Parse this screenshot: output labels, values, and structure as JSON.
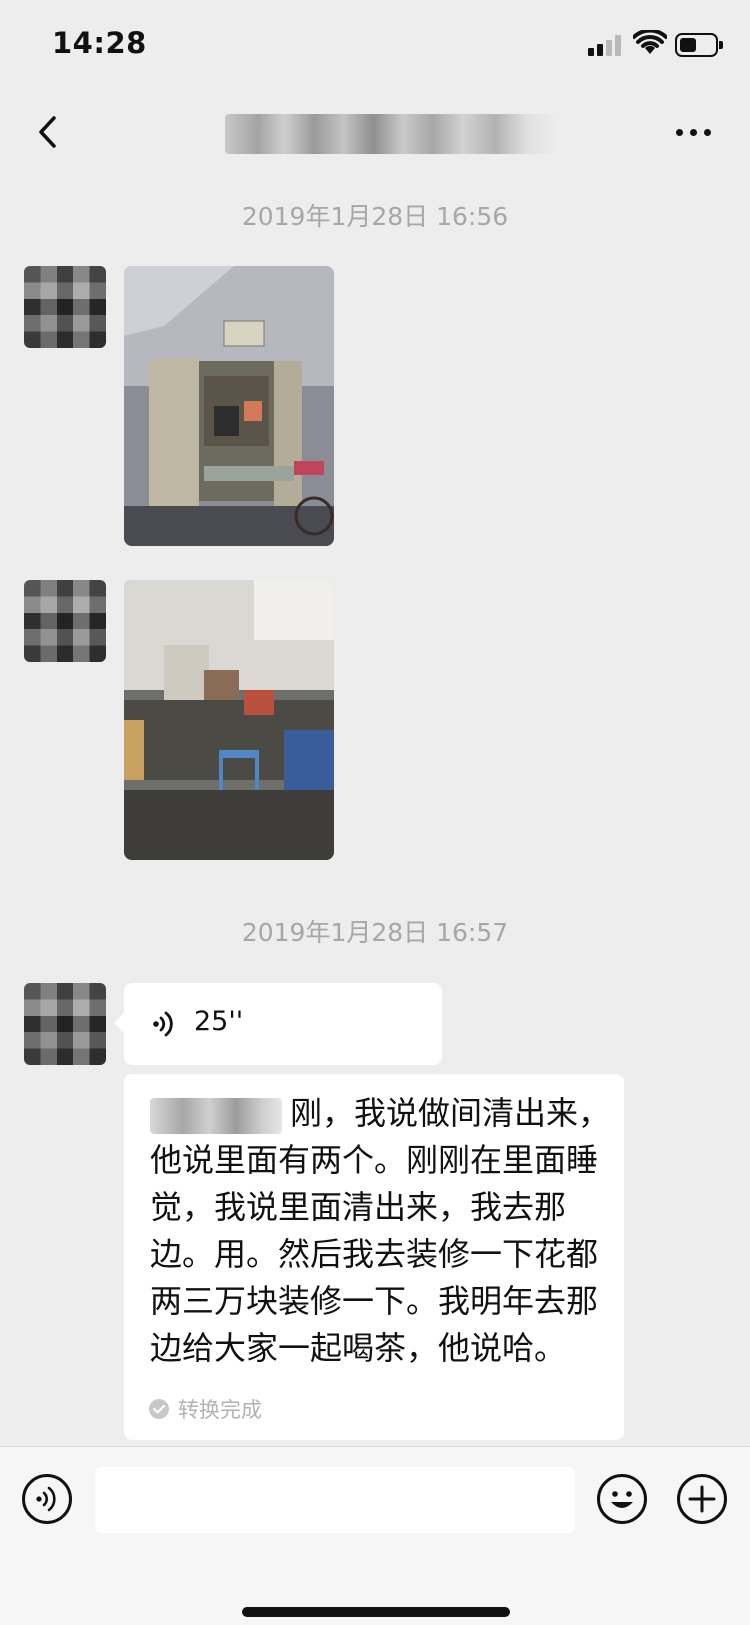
{
  "status_bar": {
    "time": "14:28"
  },
  "nav": {
    "back_icon": "chevron-left-icon",
    "title": "",
    "more_icon": "ellipsis-icon"
  },
  "messages": {
    "timestamp_1": "2019年1月28日 16:56",
    "image_1": "photo-room-doorway",
    "image_2": "photo-cluttered-room",
    "timestamp_2": "2019年1月28日 16:57",
    "voice": {
      "duration": "25''"
    },
    "transcript": {
      "text": "刚，我说做间清出来，他说里面有两个。刚刚在里面睡觉，我说里面清出来，我去那边。用。然后我去装修一下花都两三万块装修一下。我明年去那边给大家一起喝茶，他说哈。",
      "status": "转换完成"
    }
  },
  "input_bar": {
    "value": "",
    "placeholder": ""
  },
  "colors": {
    "background": "#ededed",
    "bubble": "#ffffff",
    "timestamp": "#a7a7a7",
    "status_muted": "#b2b2b2"
  }
}
